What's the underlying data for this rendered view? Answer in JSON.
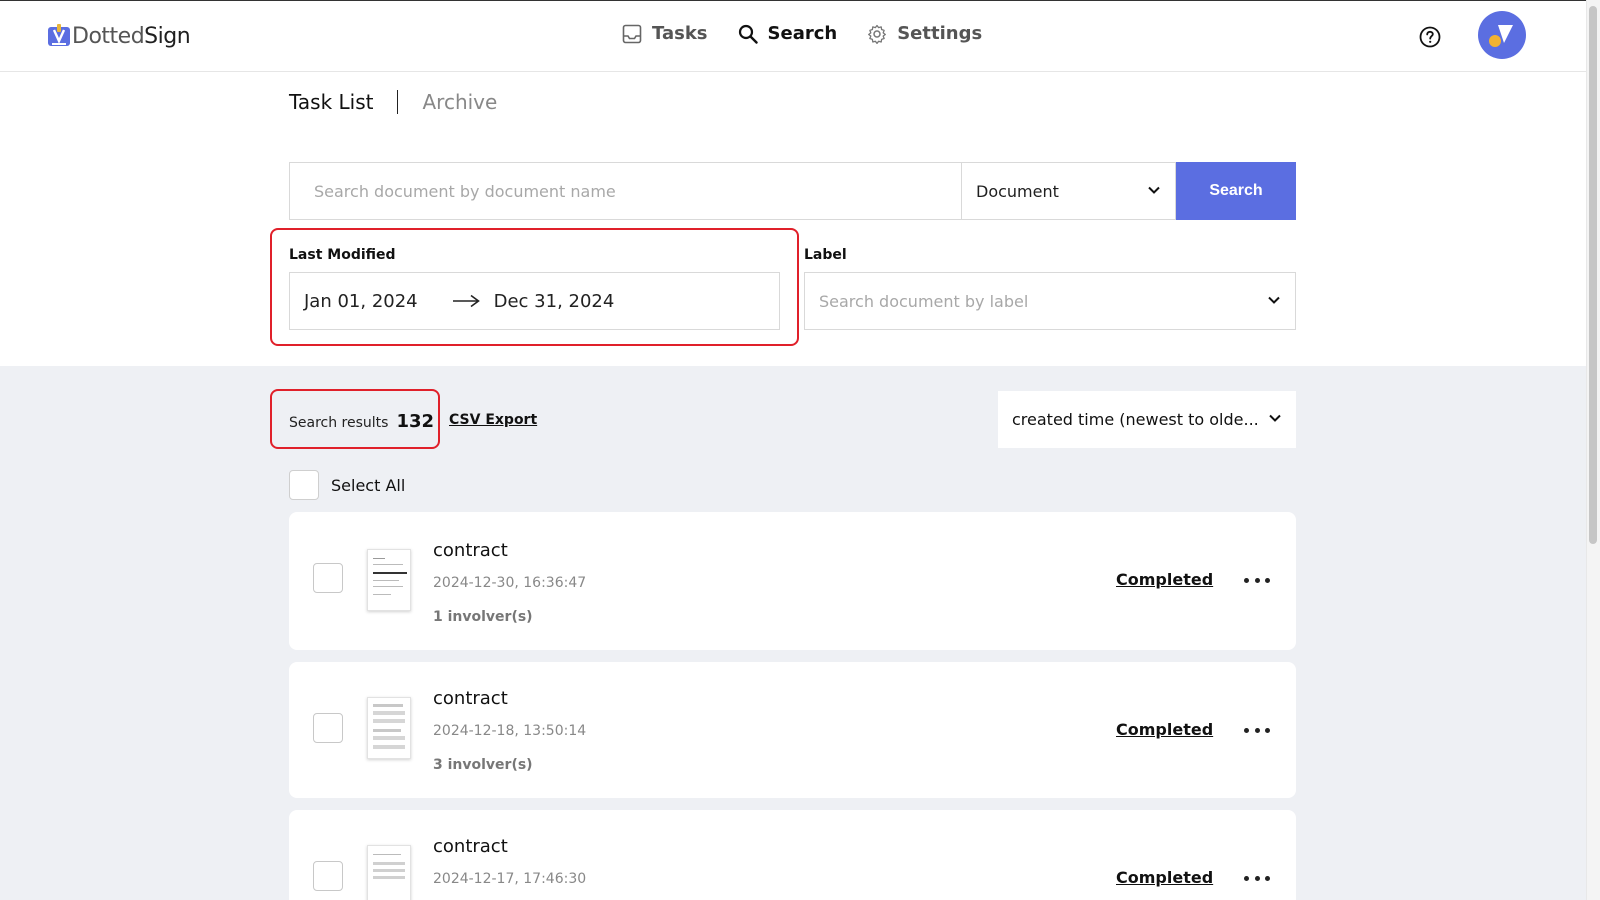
{
  "brand": {
    "name_light": "Dotted",
    "name_bold": "Sign"
  },
  "nav": [
    {
      "label": "Tasks",
      "icon": "inbox-icon",
      "active": false
    },
    {
      "label": "Search",
      "icon": "search-icon",
      "active": true
    },
    {
      "label": "Settings",
      "icon": "gear-icon",
      "active": false
    }
  ],
  "header": {
    "help_icon": "help-circle-icon",
    "avatar_icon": "avatar"
  },
  "tabs": {
    "task_list": "Task List",
    "archive": "Archive"
  },
  "search": {
    "placeholder": "Search document by document name",
    "type_value": "Document",
    "button_label": "Search"
  },
  "filters": {
    "last_modified_label": "Last Modified",
    "date_from": "Jan 01, 2024",
    "date_to": "Dec 31, 2024",
    "label_label": "Label",
    "label_placeholder": "Search document by label"
  },
  "results": {
    "label": "Search results",
    "count": "132",
    "csv_export": "CSV Export",
    "sort_value": "created time (newest to olde...",
    "select_all": "Select All"
  },
  "documents": [
    {
      "title": "contract",
      "date": "2024-12-30, 16:36:47",
      "involvers": "1 involver(s)",
      "status": "Completed"
    },
    {
      "title": "contract",
      "date": "2024-12-18, 13:50:14",
      "involvers": "3 involver(s)",
      "status": "Completed"
    },
    {
      "title": "contract",
      "date": "2024-12-17, 17:46:30",
      "involvers": "",
      "status": "Completed"
    }
  ],
  "colors": {
    "accent": "#5b6ee1",
    "highlight": "#e0202a",
    "results_background": "#eef0f4"
  }
}
